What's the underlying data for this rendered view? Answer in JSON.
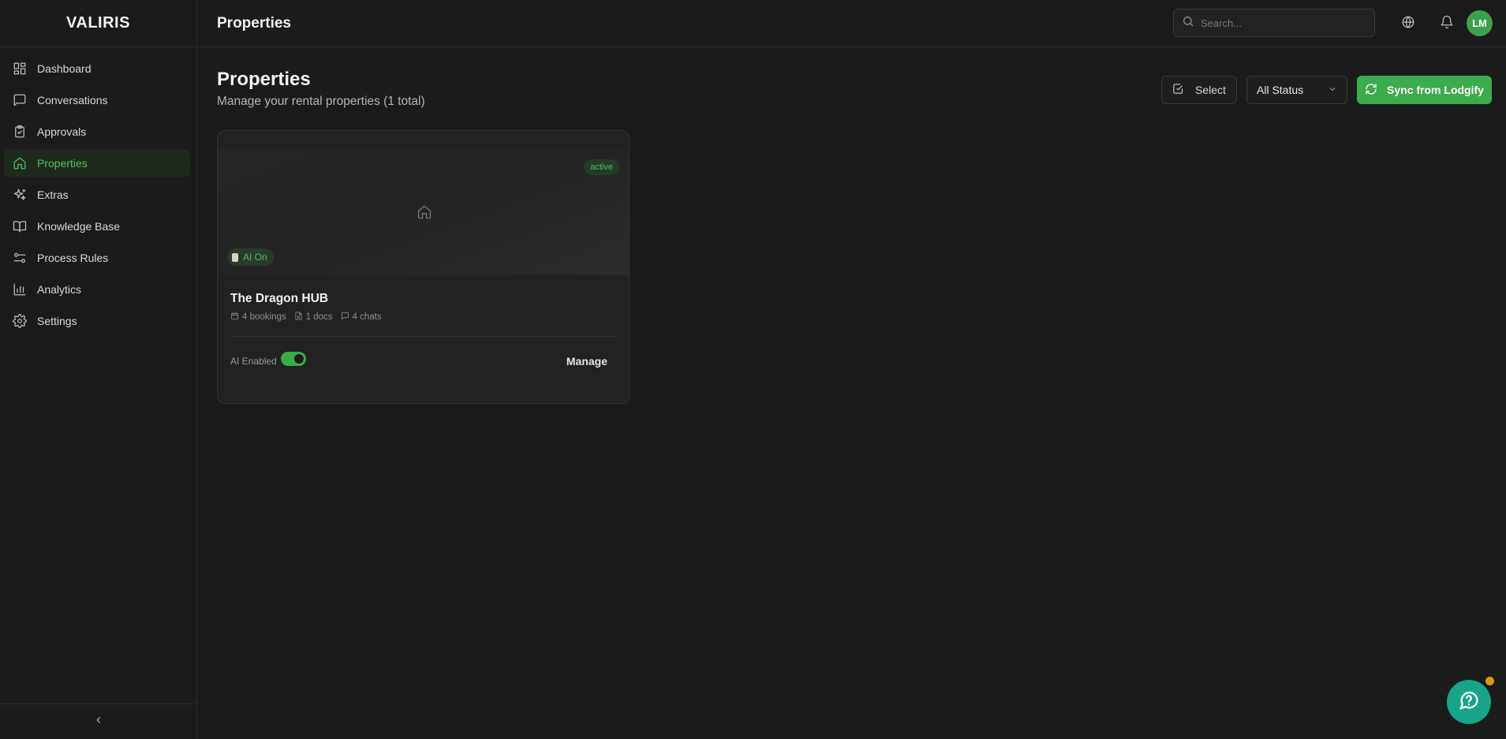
{
  "app": {
    "brand": "VALIRIS"
  },
  "sidebar": {
    "items": [
      {
        "label": "Dashboard",
        "icon": "dashboard-icon",
        "active": false
      },
      {
        "label": "Conversations",
        "icon": "message-square-icon",
        "active": false
      },
      {
        "label": "Approvals",
        "icon": "clipboard-check-icon",
        "active": false
      },
      {
        "label": "Properties",
        "icon": "home-icon",
        "active": true
      },
      {
        "label": "Extras",
        "icon": "sparkles-icon",
        "active": false
      },
      {
        "label": "Knowledge Base",
        "icon": "book-open-icon",
        "active": false
      },
      {
        "label": "Process Rules",
        "icon": "sliders-icon",
        "active": false
      },
      {
        "label": "Analytics",
        "icon": "bar-chart-icon",
        "active": false
      },
      {
        "label": "Settings",
        "icon": "gear-icon",
        "active": false
      }
    ],
    "collapse_icon": "chevron-left-icon"
  },
  "topbar": {
    "title": "Properties",
    "search_placeholder": "Search...",
    "avatar_initials": "LM"
  },
  "page": {
    "title": "Properties",
    "subtitle": "Manage your rental properties (1 total)",
    "select_label": "Select",
    "status_filter": "All Status",
    "sync_label": "Sync from Lodgify"
  },
  "properties": [
    {
      "name": "The Dragon HUB",
      "status": "active",
      "ai_badge": "AI On",
      "bookings": "4 bookings",
      "docs": "1 docs",
      "chats": "4 chats",
      "ai_enabled_label": "AI Enabled",
      "ai_enabled": true,
      "manage_label": "Manage"
    }
  ],
  "colors": {
    "accent": "#3cab4b",
    "background": "#1b1b1b",
    "help_button": "#17a589",
    "notification_dot": "#d99a16"
  }
}
